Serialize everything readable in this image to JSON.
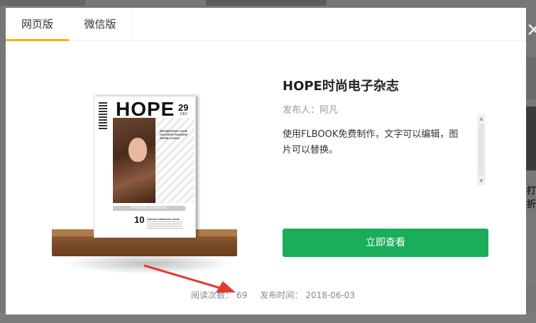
{
  "background": {
    "edge_text": "打折"
  },
  "tabs": [
    {
      "label": "网页版",
      "active": true
    },
    {
      "label": "微信版",
      "active": false
    }
  ],
  "magazine": {
    "title": "HOPE",
    "day": "29",
    "month": "DEC",
    "tagline": "RECREATING YOUR FAVORITE FASHION SHOW LOOKS",
    "band": "FASHION LOOKBOOK",
    "issue_number": "10",
    "issue_text": "Classic halloween looks"
  },
  "info": {
    "title": "HOPE时尚电子杂志",
    "publisher_label": "发布人：",
    "publisher_name": "阿凡",
    "description": "使用FLBOOK免费制作，文字可以编辑，图片可以替换。"
  },
  "view_button_label": "立即查看",
  "meta": {
    "reads_label": "阅读次数：",
    "reads_value": "69",
    "date_label": "发布时间：",
    "date_value": "2018-06-03"
  },
  "colors": {
    "accent_tab": "#f4b400",
    "primary_button": "#1aad5a",
    "arrow": "#e53935"
  }
}
